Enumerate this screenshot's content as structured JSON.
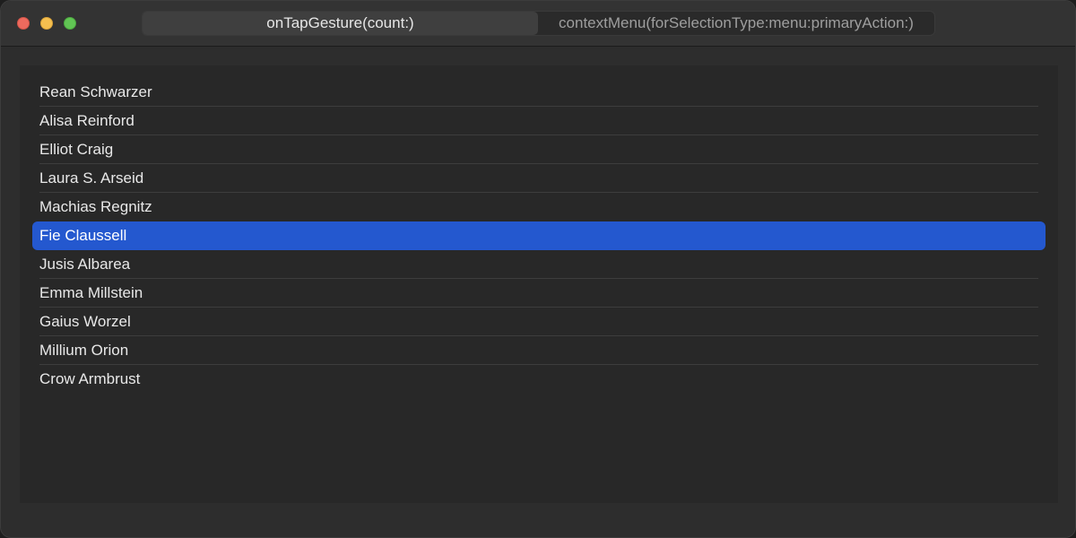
{
  "window": {
    "segments": [
      {
        "label": "onTapGesture(count:)",
        "selected": true
      },
      {
        "label": "contextMenu(forSelectionType:menu:primaryAction:)",
        "selected": false
      }
    ]
  },
  "list": {
    "selected_index": 5,
    "items": [
      "Rean Schwarzer",
      "Alisa Reinford",
      "Elliot Craig",
      "Laura S. Arseid",
      "Machias Regnitz",
      "Fie Claussell",
      "Jusis Albarea",
      "Emma Millstein",
      "Gaius Worzel",
      "Millium Orion",
      "Crow Armbrust"
    ]
  },
  "colors": {
    "selection": "#2458cf",
    "window_bg": "#2d2d2d",
    "content_bg": "#282828"
  }
}
